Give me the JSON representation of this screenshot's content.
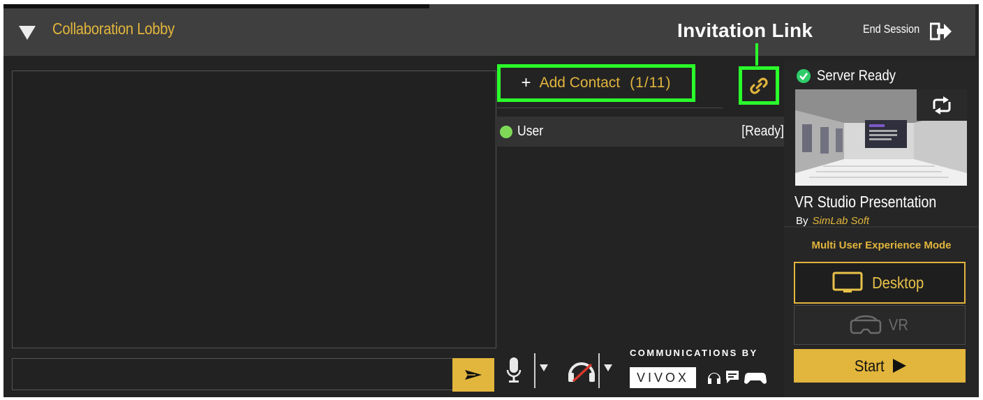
{
  "header": {
    "title": "Collaboration Lobby",
    "end_session_label": "End Session"
  },
  "annotation": {
    "invitation_link_label": "Invitation Link"
  },
  "chat": {
    "input_value": "",
    "send_icon": "send-arrow-icon"
  },
  "contacts": {
    "add_plus": "+",
    "add_label": "Add Contact",
    "count": "(1/11)",
    "users": [
      {
        "name": "User",
        "status": "[Ready]",
        "presence_color": "#7ed957"
      }
    ]
  },
  "server": {
    "status": "Server Ready",
    "status_color": "#2fcc6a"
  },
  "scene": {
    "title": "VR Studio Presentation",
    "by_prefix": "By",
    "author": "SimLab Soft"
  },
  "mode": {
    "label": "Multi User Experience Mode",
    "desktop_label": "Desktop",
    "vr_label": "VR",
    "start_label": "Start"
  },
  "comms": {
    "communications_by": "COMMUNICATIONS BY",
    "vendor": "VIVOX"
  },
  "colors": {
    "accent": "#e2b53c",
    "highlight": "#2bff2b",
    "background": "#232323"
  }
}
